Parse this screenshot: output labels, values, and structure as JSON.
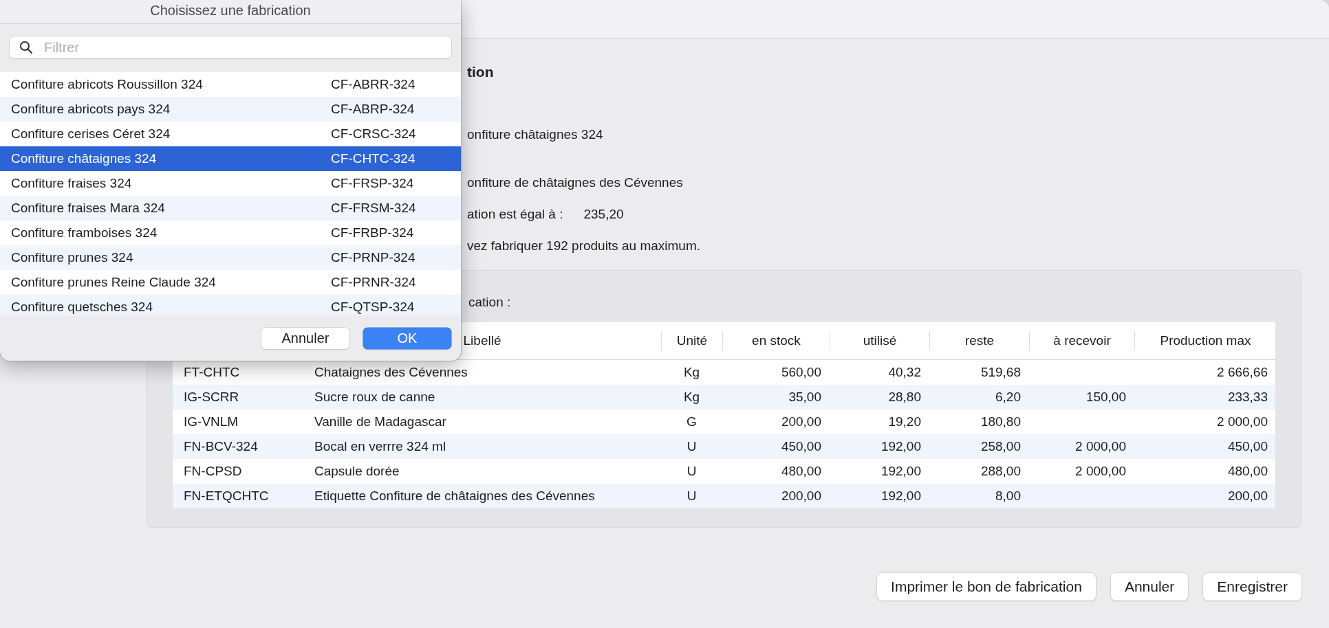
{
  "main": {
    "heading": "tion",
    "fields": [
      {
        "kind": "text",
        "text": "onfiture châtaignes 324"
      },
      {
        "kind": "text",
        "text": "onfiture de châtaignes des Cévennes"
      },
      {
        "kind": "labeled",
        "label": "ation est égal à :",
        "value": "235,20"
      },
      {
        "kind": "text",
        "text": "vez fabriquer 192 produits au maximum."
      }
    ],
    "group": {
      "label": "cation :",
      "table": {
        "columns": [
          null,
          "Libellé",
          "Unité",
          "en stock",
          "utilisé",
          "reste",
          "à recevoir",
          "Production max"
        ],
        "rows": [
          [
            "FT-CHTC",
            "Chataignes des Cévennes",
            "Kg",
            "560,00",
            "40,32",
            "519,68",
            null,
            "2 666,66"
          ],
          [
            "IG-SCRR",
            "Sucre roux de canne",
            "Kg",
            "35,00",
            "28,80",
            "6,20",
            "150,00",
            "233,33"
          ],
          [
            "IG-VNLM",
            "Vanille de Madagascar",
            "G",
            "200,00",
            "19,20",
            "180,80",
            null,
            "2 000,00"
          ],
          [
            "FN-BCV-324",
            "Bocal en verrre 324 ml",
            "U",
            "450,00",
            "192,00",
            "258,00",
            "2 000,00",
            "450,00"
          ],
          [
            "FN-CPSD",
            "Capsule dorée",
            "U",
            "480,00",
            "192,00",
            "288,00",
            "2 000,00",
            "480,00"
          ],
          [
            "FN-ETQCHTC",
            "Etiquette Confiture de châtaignes des Cévennes",
            "U",
            "200,00",
            "192,00",
            "8,00",
            null,
            "200,00"
          ]
        ]
      }
    },
    "buttons": [
      "Imprimer le bon de fabrication",
      "Annuler",
      "Enregistrer"
    ]
  },
  "sheet": {
    "title": "Choisissez une fabrication",
    "search": {
      "placeholder": "Filtrer"
    },
    "items": [
      {
        "name": "Confiture abricots Roussillon 324",
        "code": "CF-ABRR-324",
        "selected": false
      },
      {
        "name": "Confiture abricots pays 324",
        "code": "CF-ABRP-324",
        "selected": false
      },
      {
        "name": "Confiture cerises Céret 324",
        "code": "CF-CRSC-324",
        "selected": false
      },
      {
        "name": "Confiture châtaignes 324",
        "code": "CF-CHTC-324",
        "selected": true
      },
      {
        "name": "Confiture fraises 324",
        "code": "CF-FRSP-324",
        "selected": false
      },
      {
        "name": "Confiture fraises Mara 324",
        "code": "CF-FRSM-324",
        "selected": false
      },
      {
        "name": "Confiture framboises 324",
        "code": "CF-FRBP-324",
        "selected": false
      },
      {
        "name": "Confiture prunes 324",
        "code": "CF-PRNP-324",
        "selected": false
      },
      {
        "name": "Confiture prunes Reine Claude 324",
        "code": "CF-PRNR-324",
        "selected": false
      },
      {
        "name": "Confiture quetsches 324",
        "code": "CF-QTSP-324",
        "selected": false
      }
    ],
    "buttons": [
      {
        "label": "Annuler",
        "default": false
      },
      {
        "label": "OK",
        "default": true
      }
    ]
  }
}
